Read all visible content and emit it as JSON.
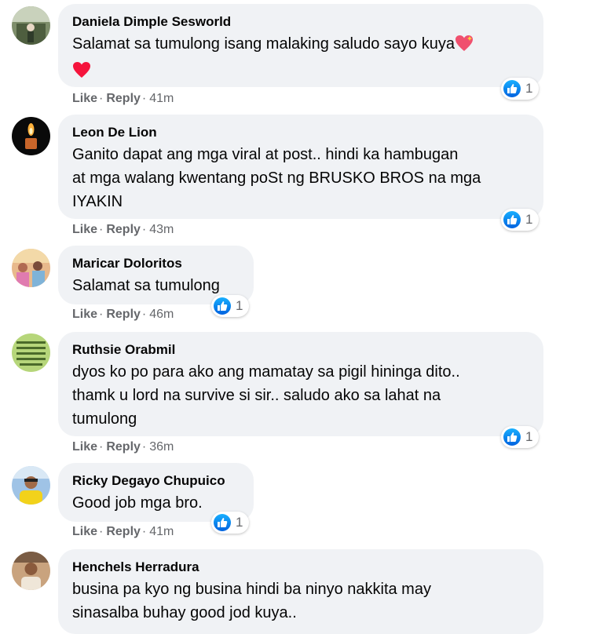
{
  "colors": {
    "bubble": "#f0f2f5",
    "like_blue": "#1877f2",
    "meta_gray": "#65676b"
  },
  "icons": {
    "reaction": "like-thumb-icon",
    "heart": "heart-emoji-icon",
    "sparkling_heart": "sparkling-heart-emoji-icon"
  },
  "comments": [
    {
      "author": "Daniela Dimple Sesworld",
      "text": "Salamat sa tumulong isang malaking saludo sayo kuya",
      "like": "Like",
      "reply": "Reply",
      "sep": "·",
      "time": "41m",
      "reactions": "1"
    },
    {
      "author": "Leon De Lion",
      "text": "Ganito dapat ang mga viral at post.. hindi ka hambugan\nat mga walang kwentang poSt ng BRUSKO BROS na mga\nIYAKIN",
      "like": "Like",
      "reply": "Reply",
      "sep": "·",
      "time": "43m",
      "reactions": "1"
    },
    {
      "author": "Maricar Doloritos",
      "text": "Salamat sa tumulong",
      "like": "Like",
      "reply": "Reply",
      "sep": "·",
      "time": "46m",
      "reactions": "1"
    },
    {
      "author": "Ruthsie Orabmil",
      "text": "dyos ko po para ako ang mamatay sa pigil hininga dito..\nthamk u lord na survive si sir.. saludo ako sa lahat na\ntumulong",
      "like": "Like",
      "reply": "Reply",
      "sep": "·",
      "time": "36m",
      "reactions": "1"
    },
    {
      "author": "Ricky Degayo Chupuico",
      "text": "Good job mga bro.",
      "like": "Like",
      "reply": "Reply",
      "sep": "·",
      "time": "41m",
      "reactions": "1"
    },
    {
      "author": "Henchels Herradura",
      "text": "busina pa kyo ng busina hindi ba ninyo nakkita may\nsinasalba buhay good jod kuya.."
    }
  ]
}
